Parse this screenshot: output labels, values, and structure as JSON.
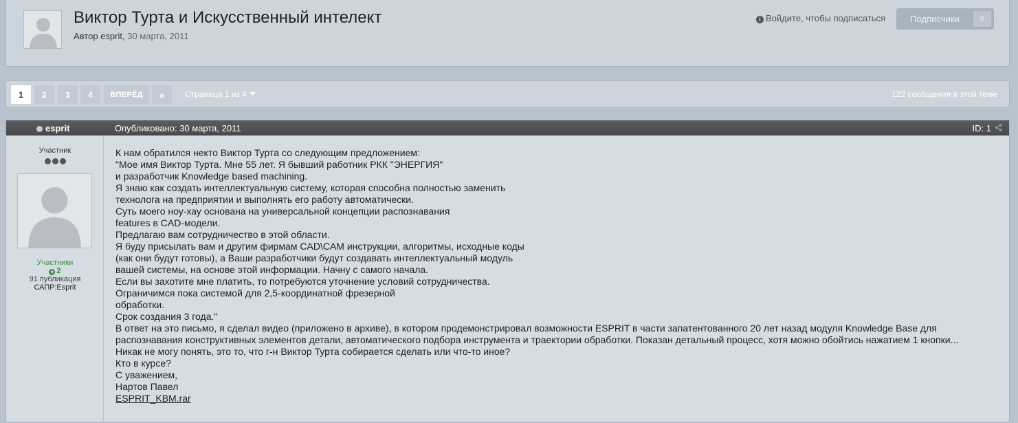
{
  "topic": {
    "title": "Виктор Турта и Искусственный интелект",
    "author_prefix": "Автор",
    "author": "esprit",
    "date": "30 марта, 2011",
    "follow_hint": "Войдите, чтобы подписаться",
    "followers_label": "Подписчики",
    "followers_count": "0"
  },
  "pagination": {
    "pages": [
      "1",
      "2",
      "3",
      "4"
    ],
    "current": "1",
    "next_label": "ВПЕРЁД",
    "last_label": "»",
    "page_of": "Страница 1 из 4",
    "post_count": "122 сообщения в этой теме"
  },
  "post": {
    "author": "esprit",
    "published": "Опубликовано: 30 марта, 2011",
    "id_label": "ID: 1",
    "author_title": "Участник",
    "author_group": "Участники",
    "author_reputation": "2",
    "author_posts": "91 публикация",
    "author_field": "САПР:Esprit",
    "body_lines": [
      "К нам обратился некто Виктор Турта со следующим предложением:",
      "\"Мое имя Виктор Турта. Мне 55 лет. Я бывший работник РКК \"ЭНЕРГИЯ\"",
      "и разработчик Knowledge based machining.",
      "Я знаю как создать интеллектуальную систему, которая способна полностью заменить",
      "технолога на предприятии и выполнять его работу автоматически.",
      "Суть моего ноу-хау основана на универсальной концепции распознавания",
      "features в CAD-модели.",
      "Предлагаю вам сотрудничество в этой области.",
      "Я буду присылать вам и другим фирмам CAD\\CAM инструкции, алгоритмы, исходные коды",
      "(как они будут готовы), а Ваши разработчики будут создавать интеллектуальный модуль",
      "вашей системы, на основе этой информации. Начну с самого начала.",
      "Если вы захотите мне платить, то потребуются уточнение условий сотрудничества.",
      "Ограничимся пока системой для 2,5-координатной фрезерной",
      "обработки.",
      "Срок создания 3 года.\"",
      "В ответ на это письмо, я сделал видео (приложено в архиве), в котором продемонстрировал возможности ESPRIT в части запатентованного 20 лет назад модуля Knowledge Base для",
      "распознавания конструктивных элементов детали, автоматического подбора инструмента и траектории обработки. Показан детальный процесс, хотя можно обойтись нажатием 1 кнопки...",
      "Никак не могу понять, это то, что г-н Виктор Турта собирается сделать или что-то иное?",
      "Кто в курсе?",
      "С уважением,",
      "Нартов Павел"
    ],
    "attachment": "ESPRIT_KBM.rar"
  },
  "icons": [
    "info-icon",
    "share-icon",
    "caret-down-icon",
    "status-dot-icon",
    "plus-icon",
    "default-avatar-icon"
  ],
  "colors": {
    "page_bg": "#b9c3cd",
    "panel_bg": "#cdd5dc",
    "post_header_bg": "#4f5255",
    "group_green": "#3d8b3d"
  }
}
